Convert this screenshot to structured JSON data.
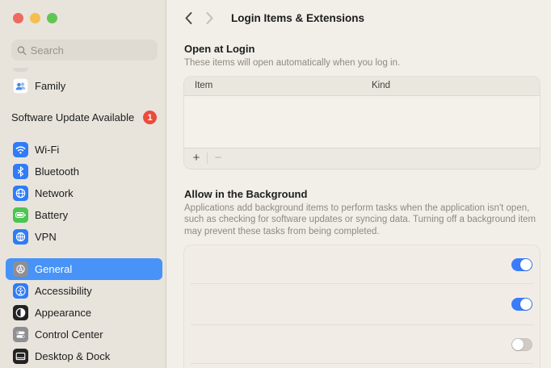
{
  "window": {
    "traffic_lights": [
      "close",
      "minimize",
      "zoom"
    ]
  },
  "sidebar": {
    "search": {
      "placeholder": "Search"
    },
    "family": {
      "label": "Family"
    },
    "software_update": {
      "label": "Software Update Available",
      "badge": "1"
    },
    "network_group": [
      {
        "label": "Wi-Fi"
      },
      {
        "label": "Bluetooth"
      },
      {
        "label": "Network"
      },
      {
        "label": "Battery"
      },
      {
        "label": "VPN"
      }
    ],
    "system_group": [
      {
        "label": "General",
        "selected": true
      },
      {
        "label": "Accessibility",
        "selected": false
      },
      {
        "label": "Appearance",
        "selected": false
      },
      {
        "label": "Control Center",
        "selected": false
      },
      {
        "label": "Desktop & Dock",
        "selected": false
      }
    ]
  },
  "header": {
    "title": "Login Items & Extensions"
  },
  "open_at_login": {
    "heading": "Open at Login",
    "subtitle": "These items will open automatically when you log in.",
    "columns": [
      "Item",
      "Kind"
    ],
    "rows": [],
    "add_label": "+",
    "remove_label": "−"
  },
  "allow_background": {
    "heading": "Allow in the Background",
    "description": "Applications add background items to perform tasks when the application isn't open, such as checking for software updates or syncing data. Turning off a background item may prevent these tasks from being completed.",
    "toggles": [
      {
        "state": "on"
      },
      {
        "state": "on"
      },
      {
        "state": "off"
      }
    ]
  },
  "colors": {
    "sidebar_bg": "#e8e4db",
    "content_bg": "#f2efe8",
    "selection_blue": "#4793f7",
    "icon_blue": "#2f7cf6",
    "icon_green": "#4cc552",
    "badge_red": "#ec4b3c",
    "toggle_on": "#3a7cfb",
    "toggle_off": "#cfcbc4"
  }
}
